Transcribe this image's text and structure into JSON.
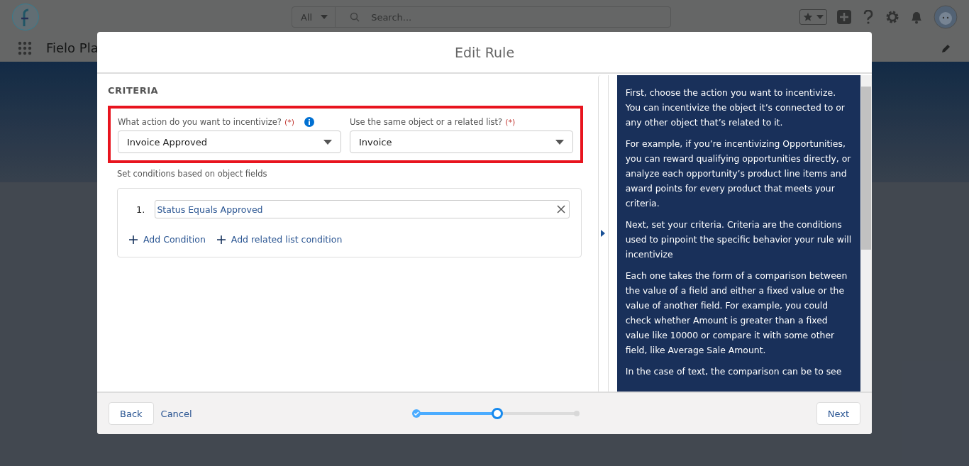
{
  "global_header": {
    "search": {
      "scope": "All",
      "placeholder": "Search..."
    }
  },
  "nav": {
    "app_name": "Fielo Pla"
  },
  "modal": {
    "title": "Edit Rule",
    "section_heading": "CRITERIA",
    "fields": [
      {
        "label": "What action do you want to incentivize?",
        "required_mark": "(*)",
        "info": true,
        "value": "Invoice Approved"
      },
      {
        "label": "Use the same object or a related list?",
        "required_mark": "(*)",
        "info": false,
        "value": "Invoice"
      }
    ],
    "conditions_hint": "Set conditions based on object fields",
    "conditions": [
      {
        "number": "1.",
        "text": "Status Equals Approved"
      }
    ],
    "condition_actions": [
      "Add Condition",
      "Add related list condition"
    ],
    "help_paragraphs": [
      "First, choose the action you want to incentivize. You can incentivize the object it’s connected to or any other object that’s related to it.",
      "For example, if you’re incentivizing Opportunities, you can reward qualifying opportunities directly, or analyze each opportunity’s product line items and award points for every product that meets your criteria.",
      "Next, set your criteria. Criteria are the conditions used to pinpoint the specific behavior your rule will incentivize",
      "Each one takes the form of a comparison between the value of a field and either a fixed value or the value of another field. For example, you could check whether Amount is greater than a fixed value like 10000 or compare it with some other field, like Average Sale Amount.",
      "In the case of text, the comparison can be to see"
    ],
    "footer": {
      "back": "Back",
      "cancel": "Cancel",
      "next": "Next",
      "steps": [
        {
          "kind": "complete"
        },
        {
          "kind": "current"
        },
        {
          "kind": "upcoming"
        }
      ],
      "progress": {
        "level": 0.5
      }
    }
  }
}
